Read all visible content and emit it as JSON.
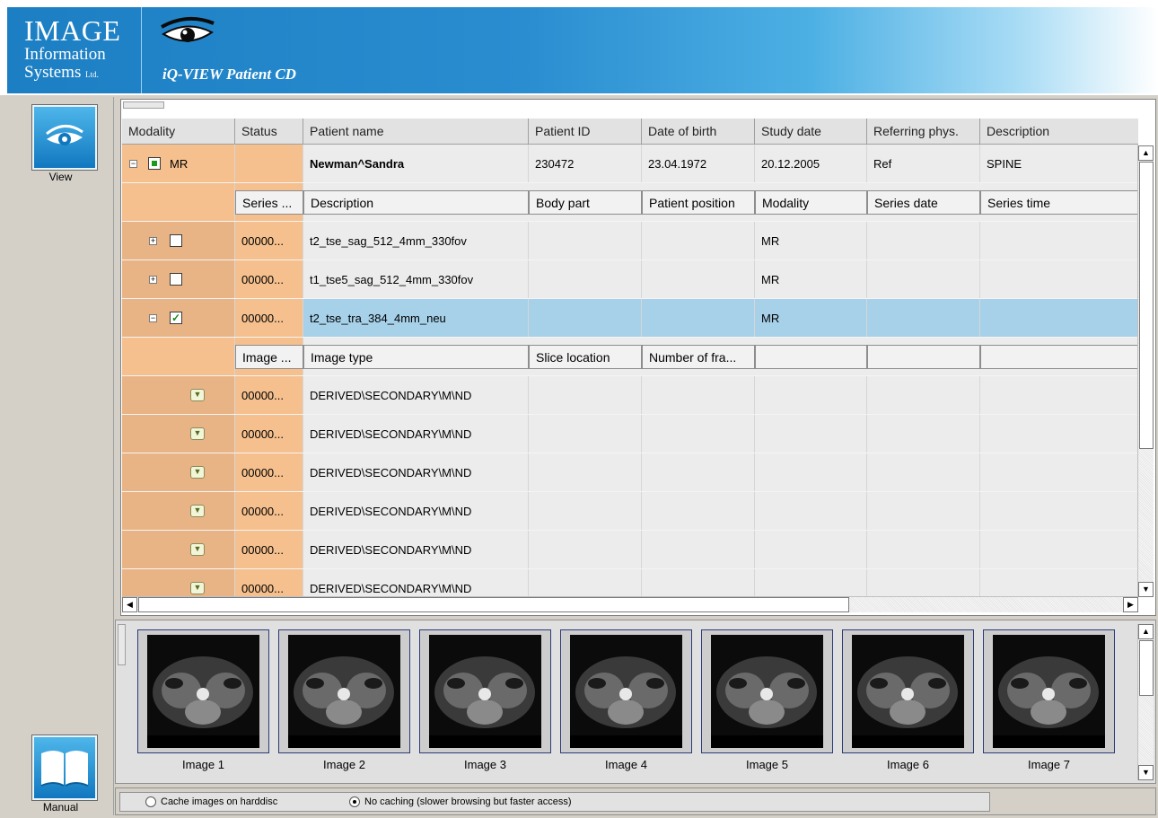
{
  "header": {
    "logo_line1": "IMAGE",
    "logo_line2": "Information",
    "logo_line3": "Systems",
    "logo_ltd": "Ltd.",
    "app_title": "iQ-VIEW Patient CD"
  },
  "sidebar": {
    "view_label": "View",
    "manual_label": "Manual"
  },
  "grid": {
    "columns": [
      "Modality",
      "Status",
      "Patient name",
      "Patient ID",
      "Date of birth",
      "Study date",
      "Referring phys.",
      "Description"
    ],
    "patient": {
      "toggle": "−",
      "modality": "MR",
      "status": "",
      "name": "Newman^Sandra",
      "id": "230472",
      "dob": "23.04.1972",
      "study_date": "20.12.2005",
      "ref_phys": "Ref",
      "description": "SPINE"
    },
    "series_headers": [
      "Series ...",
      "Description",
      "Body part",
      "Patient position",
      "Modality",
      "Series date",
      "Series time"
    ],
    "series": [
      {
        "toggle": "+",
        "checked": false,
        "number": "00000...",
        "description": "t2_tse_sag_512_4mm_330fov",
        "body_part": "",
        "position": "",
        "modality": "MR",
        "date": "",
        "time": ""
      },
      {
        "toggle": "+",
        "checked": false,
        "number": "00000...",
        "description": "t1_tse5_sag_512_4mm_330fov",
        "body_part": "",
        "position": "",
        "modality": "MR",
        "date": "",
        "time": ""
      },
      {
        "toggle": "−",
        "checked": true,
        "number": "00000...",
        "description": "t2_tse_tra_384_4mm_neu",
        "body_part": "",
        "position": "",
        "modality": "MR",
        "date": "",
        "time": "",
        "selected": true
      }
    ],
    "image_headers": [
      "Image ...",
      "Image type",
      "Slice location",
      "Number of fra..."
    ],
    "images": [
      {
        "number": "00000...",
        "type": "DERIVED\\SECONDARY\\M\\ND"
      },
      {
        "number": "00000...",
        "type": "DERIVED\\SECONDARY\\M\\ND"
      },
      {
        "number": "00000...",
        "type": "DERIVED\\SECONDARY\\M\\ND"
      },
      {
        "number": "00000...",
        "type": "DERIVED\\SECONDARY\\M\\ND"
      },
      {
        "number": "00000...",
        "type": "DERIVED\\SECONDARY\\M\\ND"
      },
      {
        "number": "00000...",
        "type": "DERIVED\\SECONDARY\\M\\ND"
      }
    ]
  },
  "thumbnails": [
    "Image 1",
    "Image 2",
    "Image 3",
    "Image 4",
    "Image 5",
    "Image 6",
    "Image 7"
  ],
  "status": {
    "option_cache": "Cache images on harddisc",
    "option_nocache": "No caching (slower browsing but faster access)",
    "selected": "nocache"
  },
  "colors": {
    "header_blue": "#1d7fc3",
    "row_orange": "#f5c08e",
    "selected_row": "#a6d1e9"
  },
  "icons": [
    "eye-icon",
    "book-icon",
    "expand-icon",
    "collapse-icon",
    "dropdown-icon",
    "scroll-up-icon",
    "scroll-down-icon",
    "scroll-left-icon",
    "scroll-right-icon"
  ]
}
